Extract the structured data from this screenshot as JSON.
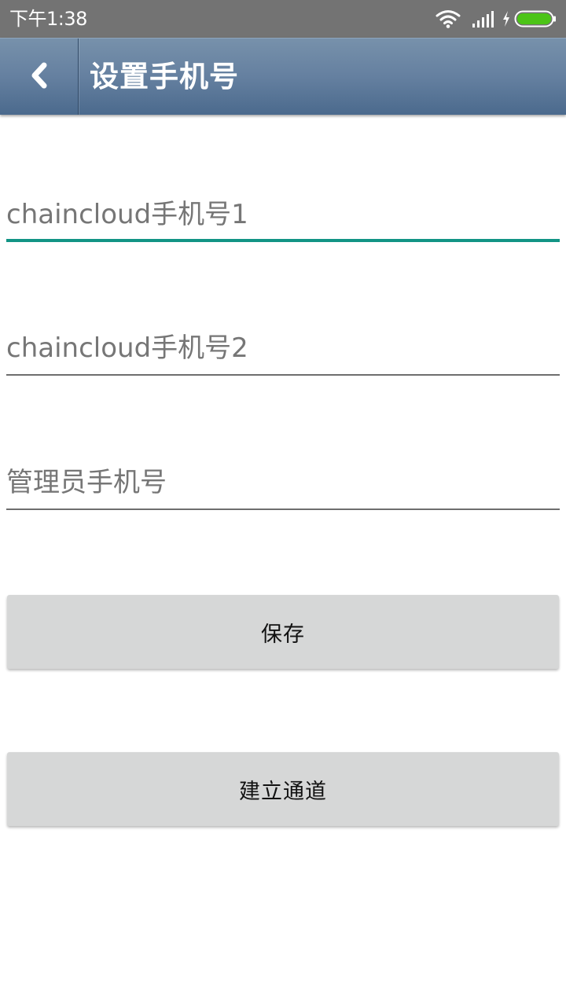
{
  "status_bar": {
    "time": "下午1:38",
    "icons": [
      "wifi-icon",
      "signal-icon",
      "charging-icon",
      "battery-icon"
    ],
    "battery_color": "#4cc417"
  },
  "app_bar": {
    "back_icon": "chevron-left-icon",
    "title": "设置手机号",
    "background_color": "#5f7b9c"
  },
  "form": {
    "fields": [
      {
        "placeholder": "chaincloud手机号1",
        "value": "",
        "focused": true
      },
      {
        "placeholder": "chaincloud手机号2",
        "value": "",
        "focused": false
      },
      {
        "placeholder": "管理员手机号",
        "value": "",
        "focused": false
      }
    ],
    "focus_color": "#129485"
  },
  "buttons": {
    "save_label": "保存",
    "build_channel_label": "建立通道"
  }
}
